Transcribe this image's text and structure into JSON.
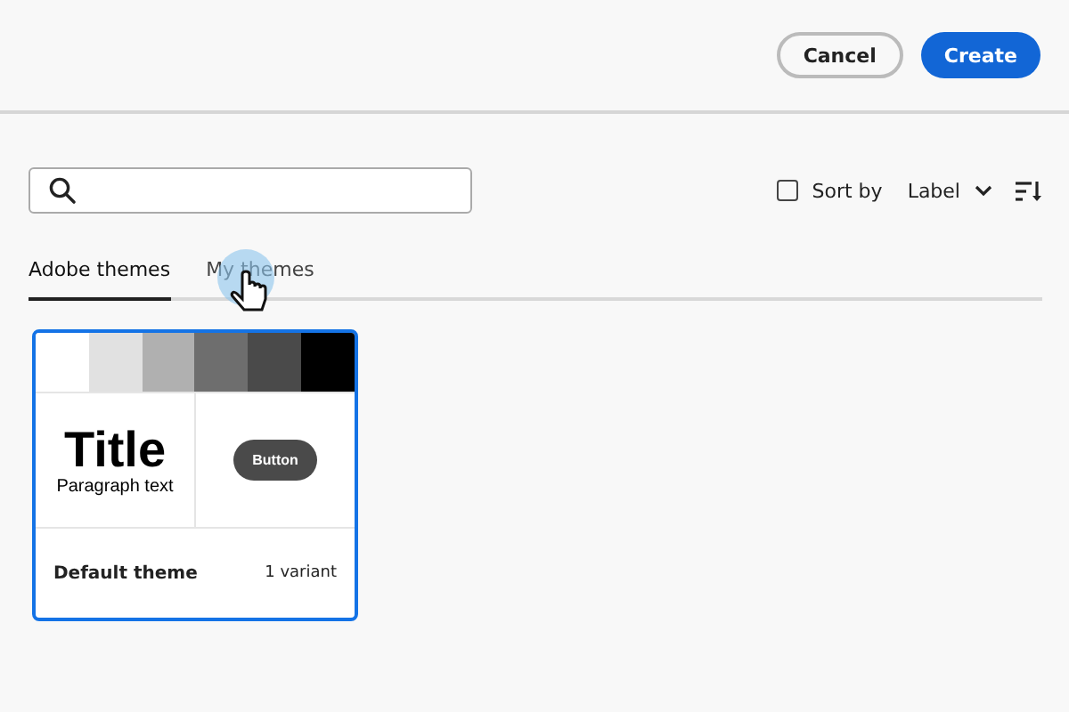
{
  "header": {
    "buttons": [
      {
        "label": "Cancel",
        "kind": "secondary"
      },
      {
        "label": "Create",
        "kind": "primary"
      }
    ]
  },
  "sort": {
    "checked": false,
    "label": "Sort by",
    "field": "Label"
  },
  "tabs": [
    {
      "label": "Adobe themes",
      "selected": true
    },
    {
      "label": "My themes",
      "selected": false
    }
  ],
  "themes": [
    {
      "name": "Default theme",
      "variants": "1 variant",
      "selected": true,
      "title": "Title",
      "paragraph": "Paragraph text",
      "button": "Button",
      "swatches": [
        {
          "color": "#ffffff"
        },
        {
          "color": "#e1e1e1"
        },
        {
          "color": "#b0b0b0"
        },
        {
          "color": "#6e6e6e"
        },
        {
          "color": "#4a4a4a"
        },
        {
          "color": "#000000"
        }
      ]
    }
  ]
}
